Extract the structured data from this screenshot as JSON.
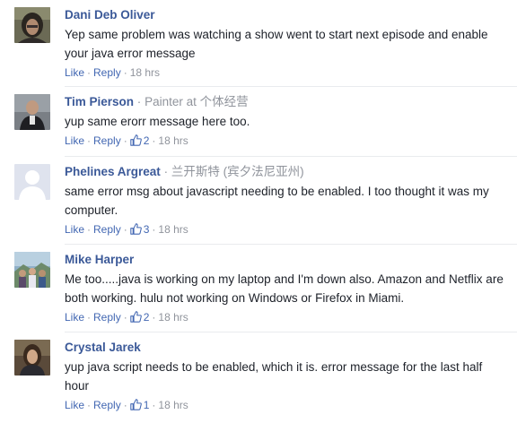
{
  "comments": [
    {
      "author": "Dani Deb Oliver",
      "subtitle": "",
      "text": "Yep same problem was watching a show went to start next episode and enable your java error message",
      "like_label": "Like",
      "reply_label": "Reply",
      "likes": "",
      "time": "18 hrs"
    },
    {
      "author": "Tim Pierson",
      "subtitle": "Painter at 个体经营",
      "text": "yup same erorr message here too.",
      "like_label": "Like",
      "reply_label": "Reply",
      "likes": "2",
      "time": "18 hrs"
    },
    {
      "author": "Phelines Argreat",
      "subtitle": "兰开斯特 (宾夕法尼亚州)",
      "text": "same error msg about javascript needing to be enabled. I too thought it was my computer.",
      "like_label": "Like",
      "reply_label": "Reply",
      "likes": "3",
      "time": "18 hrs"
    },
    {
      "author": "Mike Harper",
      "subtitle": "",
      "text": "Me too.....java is working on my laptop and I'm down also. Amazon and Netflix are both working. hulu not working on Windows or Firefox in Miami.",
      "like_label": "Like",
      "reply_label": "Reply",
      "likes": "2",
      "time": "18 hrs"
    },
    {
      "author": "Crystal Jarek",
      "subtitle": "",
      "text": "yup java script needs to be enabled, which it is. error message for the last half hour",
      "like_label": "Like",
      "reply_label": "Reply",
      "likes": "1",
      "time": "18 hrs"
    }
  ],
  "colors": {
    "author": "#3b5998",
    "link": "#4267b2",
    "meta": "#90949c",
    "text": "#1d2129"
  }
}
